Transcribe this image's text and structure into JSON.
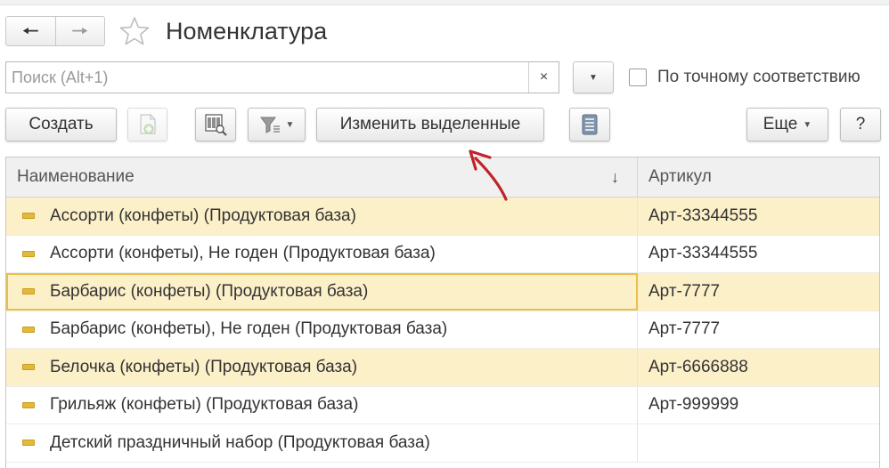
{
  "window": {
    "title": "Номенклатура"
  },
  "nav": {
    "back_icon": "arrow-left-icon",
    "forward_icon": "arrow-right-icon",
    "favorite_icon": "star-icon"
  },
  "search": {
    "placeholder": "Поиск (Alt+1)",
    "value": "",
    "clear_label": "×"
  },
  "exact_match": {
    "label": "По точному соответствию",
    "checked": false
  },
  "toolbar": {
    "create_label": "Создать",
    "copy_icon": "copy-document-icon",
    "barcode_icon": "barcode-search-icon",
    "filter_icon": "filter-icon",
    "edit_selected_label": "Изменить выделенные",
    "list_icon": "list-icon",
    "more_label": "Еще",
    "help_label": "?"
  },
  "table": {
    "columns": [
      "Наименование",
      "Артикул"
    ],
    "sort_indicator": "↓",
    "rows": [
      {
        "name": "Ассорти (конфеты) (Продуктовая база)",
        "article": "Арт-33344555"
      },
      {
        "name": "Ассорти (конфеты), Не годен (Продуктовая база)",
        "article": "Арт-33344555"
      },
      {
        "name": "Барбарис (конфеты) (Продуктовая база)",
        "article": "Арт-7777"
      },
      {
        "name": "Барбарис (конфеты), Не годен (Продуктовая база)",
        "article": "Арт-7777"
      },
      {
        "name": "Белочка (конфеты) (Продуктовая база)",
        "article": "Арт-6666888"
      },
      {
        "name": "Грильяж (конфеты) (Продуктовая база)",
        "article": "Арт-999999"
      },
      {
        "name": "Детский праздничный набор (Продуктовая база)",
        "article": ""
      }
    ]
  },
  "colors": {
    "selected_row": "#fcf0c9",
    "current_row_border": "#e7c04a",
    "marker": "#e2b93b",
    "annotation_arrow": "#c0232a"
  }
}
